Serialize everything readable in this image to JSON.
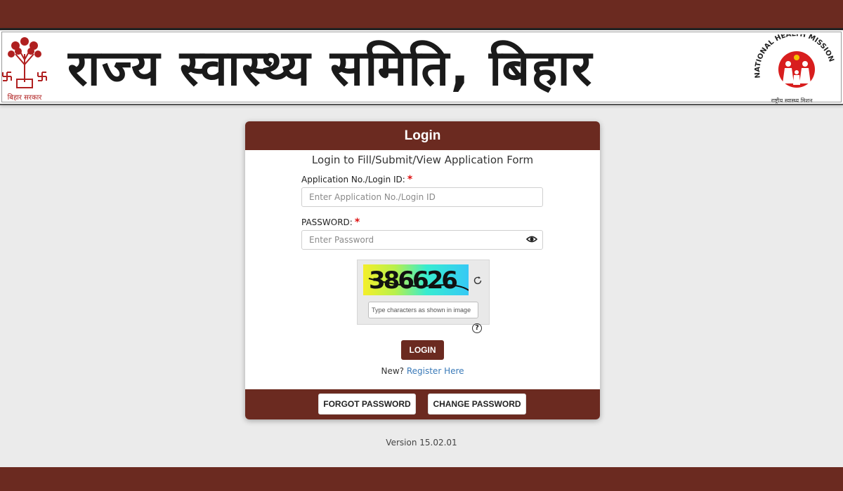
{
  "banner": {
    "title": "राज्य स्वास्थ्य समिति, बिहार",
    "left_emblem_caption": "बिहार सरकार",
    "right_emblem_caption": "राष्ट्रीय स्वास्थ्य मिशन",
    "right_emblem_arc_text": "NATIONAL HEALTH MISSION"
  },
  "login": {
    "heading": "Login",
    "subtitle": "Login to Fill/Submit/View Application Form",
    "app_id_label": "Application No./Login ID:",
    "app_id_placeholder": "Enter Application No./Login ID",
    "password_label": "PASSWORD:",
    "password_placeholder": "Enter Password",
    "required_mark": "*",
    "captcha_text": "386626",
    "captcha_placeholder": "Type characters as shown in image",
    "help_glyph": "?",
    "login_button": "LOGIN",
    "new_prompt": "New?",
    "register_link": "Register Here",
    "forgot_button": "FORGOT PASSWORD",
    "change_button": "CHANGE PASSWORD"
  },
  "footer": {
    "version": "Version 15.02.01"
  },
  "colors": {
    "brand": "#6b2a20",
    "page_bg": "#ebebeb",
    "link": "#3a7ab8",
    "required": "#dd1111"
  },
  "icons": [
    "eye-icon",
    "refresh-icon",
    "help-icon",
    "swastika-icon",
    "tree-emblem-icon",
    "nhm-family-icon"
  ]
}
